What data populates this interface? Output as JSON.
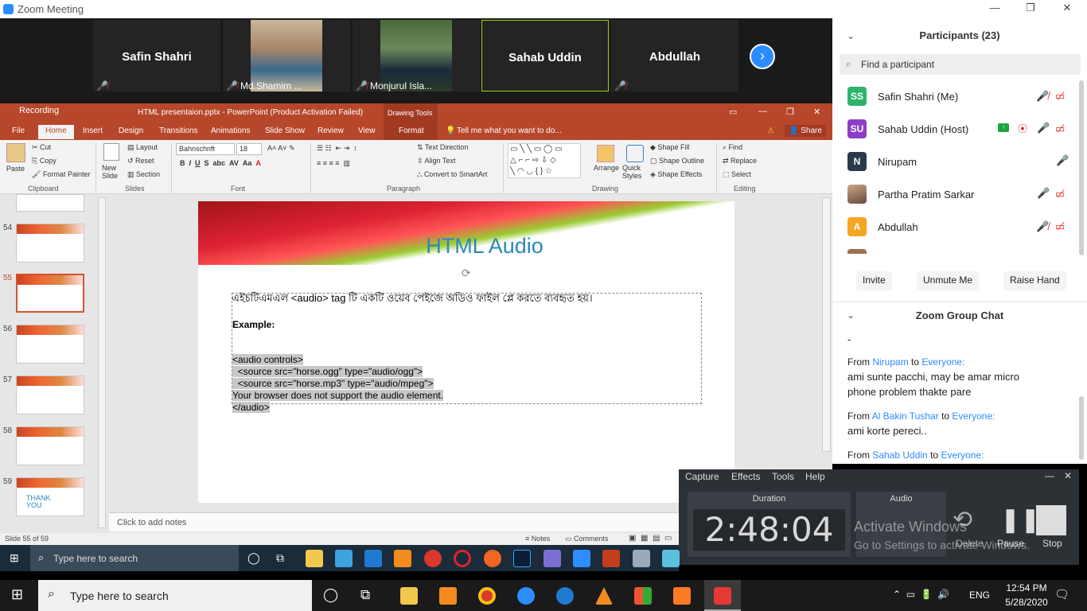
{
  "zoom": {
    "window_title": "Zoom Meeting",
    "tiles": [
      {
        "name": "Safin Shahri",
        "label": ""
      },
      {
        "name": "",
        "label": "Md.Shamim ..."
      },
      {
        "name": "",
        "label": "Monjurul Isla..."
      },
      {
        "name": "Sahab Uddin",
        "label": ""
      },
      {
        "name": "Abdullah",
        "label": ""
      }
    ]
  },
  "ppt": {
    "qat_label": "Recording",
    "window_title": "HTML presentaion.pptx - PowerPoint (Product Activation Failed)",
    "contextual": "Drawing Tools",
    "tabs": [
      "File",
      "Home",
      "Insert",
      "Design",
      "Transitions",
      "Animations",
      "Slide Show",
      "Review",
      "View",
      "Format"
    ],
    "tell_me": "Tell me what you want to do...",
    "share": "Share",
    "ribbon": {
      "paste": "Paste",
      "cut": "Cut",
      "copy": "Copy",
      "format_painter": "Format Painter",
      "clipboard": "Clipboard",
      "new_slide": "New Slide",
      "layout": "Layout",
      "reset": "Reset",
      "section": "Section",
      "slides": "Slides",
      "font_name": "Bahnschrift",
      "font_size": "18",
      "font": "Font",
      "text_direction": "Text Direction",
      "align_text": "Align Text",
      "convert_smartart": "Convert to SmartArt",
      "paragraph": "Paragraph",
      "arrange": "Arrange",
      "quick_styles": "Quick Styles",
      "shape_fill": "Shape Fill",
      "shape_outline": "Shape Outline",
      "shape_effects": "Shape Effects",
      "drawing": "Drawing",
      "find": "Find",
      "replace": "Replace",
      "select": "Select",
      "editing": "Editing"
    },
    "thumbnails": [
      "54",
      "55",
      "56",
      "57",
      "58",
      "59"
    ],
    "thumb_last_text": "THANK YOU",
    "slide": {
      "title": "HTML Audio",
      "line1": "এইচটিএমএল <audio> tag টি একটি ওয়েব পেইজে অডিও ফাইল প্লে করতে ব্যবহৃত হয়।",
      "example": "Example:",
      "code": [
        "<audio controls>",
        "  <source src=\"horse.ogg\" type=\"audio/ogg\">",
        "  <source src=\"horse.mp3\" type=\"audio/mpeg\">",
        "Your browser does not support the audio element.",
        "</audio>"
      ]
    },
    "notes_placeholder": "Click to add notes",
    "status": {
      "slide": "Slide 55 of 59",
      "notes": "Notes",
      "comments": "Comments"
    }
  },
  "panel": {
    "participants_title": "Participants (23)",
    "search_placeholder": "Find a participant",
    "participants": [
      {
        "initials": "SS",
        "name": "Safin Shahri (Me)",
        "color": "#2fb36b"
      },
      {
        "initials": "SU",
        "name": "Sahab Uddin (Host)",
        "color": "#8b3fc6"
      },
      {
        "initials": "N",
        "name": "Nirupam",
        "color": "#2b3a4a"
      },
      {
        "initials": "",
        "name": "Partha Pratim Sarkar",
        "color": "#8a6a4a"
      },
      {
        "initials": "A",
        "name": "Abdullah",
        "color": "#f5a623"
      }
    ],
    "buttons": {
      "invite": "Invite",
      "unmute": "Unmute Me",
      "raise": "Raise Hand"
    },
    "chat_title": "Zoom Group Chat",
    "chat": [
      {
        "from": "Nirupam",
        "to": "Everyone:",
        "text": [
          "ami sunte pacchi, may be amar micro",
          "phone problem thakte pare"
        ]
      },
      {
        "from": "Al Bakin Tushar",
        "to": "Everyone:",
        "text": [
          "ami korte pereci.."
        ]
      },
      {
        "from": "Sahab Uddin",
        "to": "Everyone:",
        "text": []
      }
    ],
    "dash": "-",
    "from_word": "From",
    "to_word": "to"
  },
  "recorder": {
    "menu": [
      "Capture",
      "Effects",
      "Tools",
      "Help"
    ],
    "duration_label": "Duration",
    "time": "2:48:04",
    "audio_label": "Audio",
    "delete": "Delete",
    "pause": "Pause",
    "stop": "Stop",
    "activate1": "Activate Windows",
    "activate2": "Go to Settings to activate Windows."
  },
  "taskbar": {
    "inner_search": "Type here to search",
    "search": "Type here to search",
    "lang": "ENG",
    "time": "12:54 PM",
    "date": "5/28/2020"
  }
}
